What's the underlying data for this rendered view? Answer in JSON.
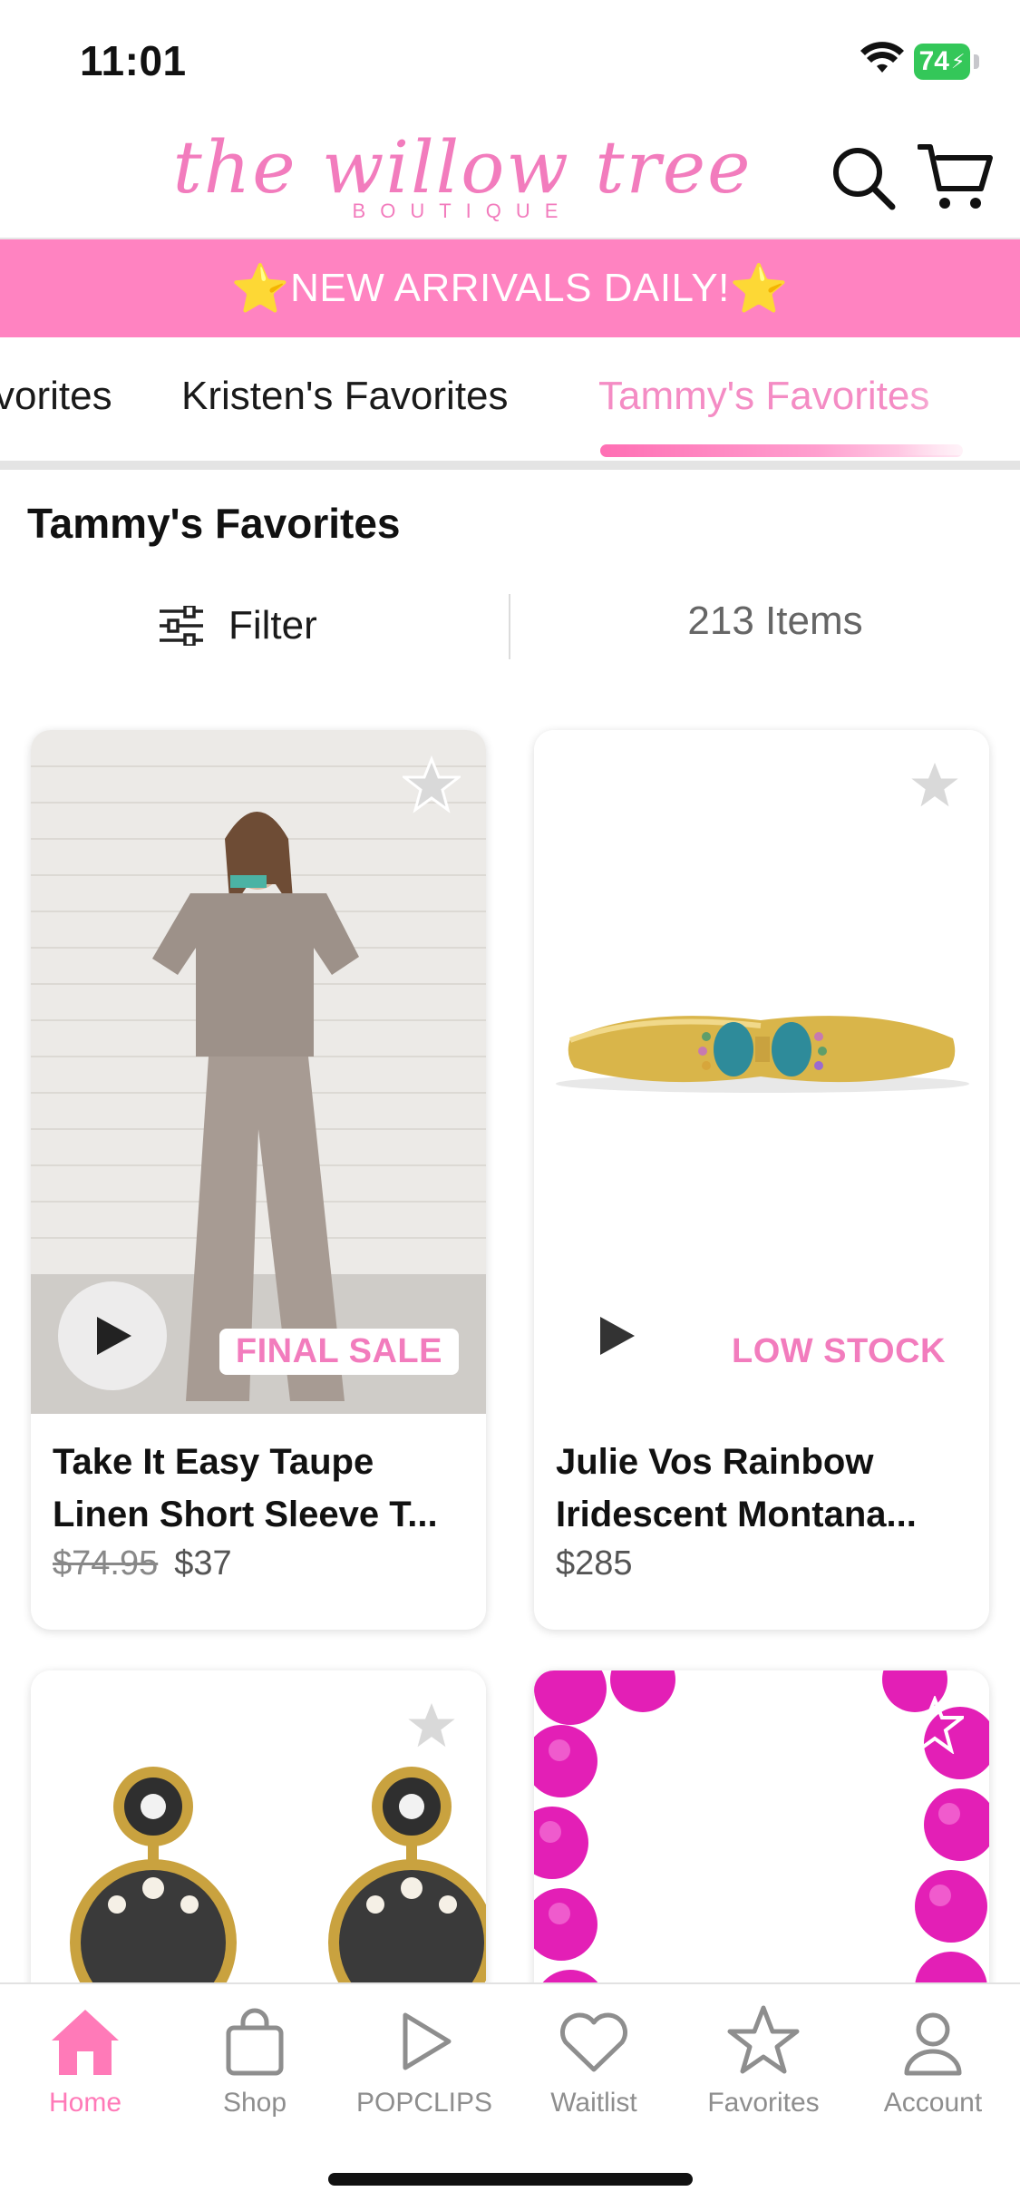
{
  "status_bar": {
    "time": "11:01",
    "battery": "74"
  },
  "header": {
    "logo_script": "the willow tree",
    "logo_sub": "BOUTIQUE"
  },
  "banner": {
    "star_left": "⭐",
    "text": "NEW ARRIVALS DAILY!",
    "star_right": "⭐"
  },
  "tabs": [
    {
      "label": "vorites"
    },
    {
      "label": "Kristen's Favorites"
    },
    {
      "label": "Tammy's Favorites",
      "active": true
    }
  ],
  "page": {
    "title": "Tammy's Favorites",
    "filter_label": "Filter",
    "item_count": "213 Items"
  },
  "products": [
    {
      "name": "Take It Easy Taupe Linen Short Sleeve T...",
      "old_price": "$74.95",
      "price": "$37",
      "badge": "FINAL SALE"
    },
    {
      "name": "Julie Vos Rainbow Iridescent Montana...",
      "old_price": "",
      "price": "$285",
      "badge": "LOW STOCK"
    },
    {
      "name": "",
      "price": "",
      "badge": ""
    },
    {
      "name": "",
      "price": "",
      "badge": ""
    }
  ],
  "bottom_nav": [
    {
      "label": "Home",
      "icon": "home-icon",
      "active": true
    },
    {
      "label": "Shop",
      "icon": "shopping-bag-icon"
    },
    {
      "label": "POPCLIPS",
      "icon": "play-icon"
    },
    {
      "label": "Waitlist",
      "icon": "heart-icon"
    },
    {
      "label": "Favorites",
      "icon": "star-icon"
    },
    {
      "label": "Account",
      "icon": "person-icon"
    }
  ],
  "colors": {
    "brand_pink": "#ff83c1",
    "accent_pink": "#f27cbd",
    "battery_green": "#34c759"
  }
}
